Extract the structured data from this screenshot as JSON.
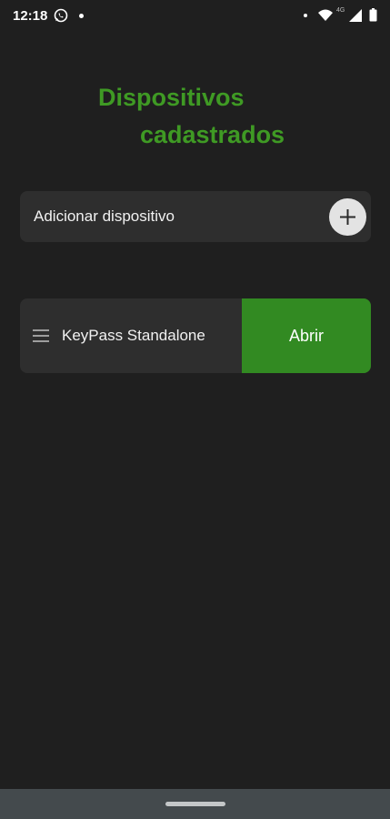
{
  "status_bar": {
    "time": "12:18",
    "network_type": "4G",
    "icons": [
      "whatsapp-icon",
      "notification-dot",
      "wifi-icon",
      "signal-icon",
      "battery-icon"
    ]
  },
  "page": {
    "title_line1": "Dispositivos",
    "title_line2": "cadastrados",
    "accent_color": "#3f9a24"
  },
  "add_device": {
    "label": "Adicionar dispositivo",
    "button_icon": "plus-icon"
  },
  "devices": [
    {
      "name": "KeyPass Standalone",
      "action_label": "Abrir",
      "action_color": "#328a22",
      "handle_icon": "drag-handle-icon"
    }
  ],
  "colors": {
    "background": "#1f1f1f",
    "card": "#2e2e2e",
    "nav_bar": "#444a4d"
  }
}
